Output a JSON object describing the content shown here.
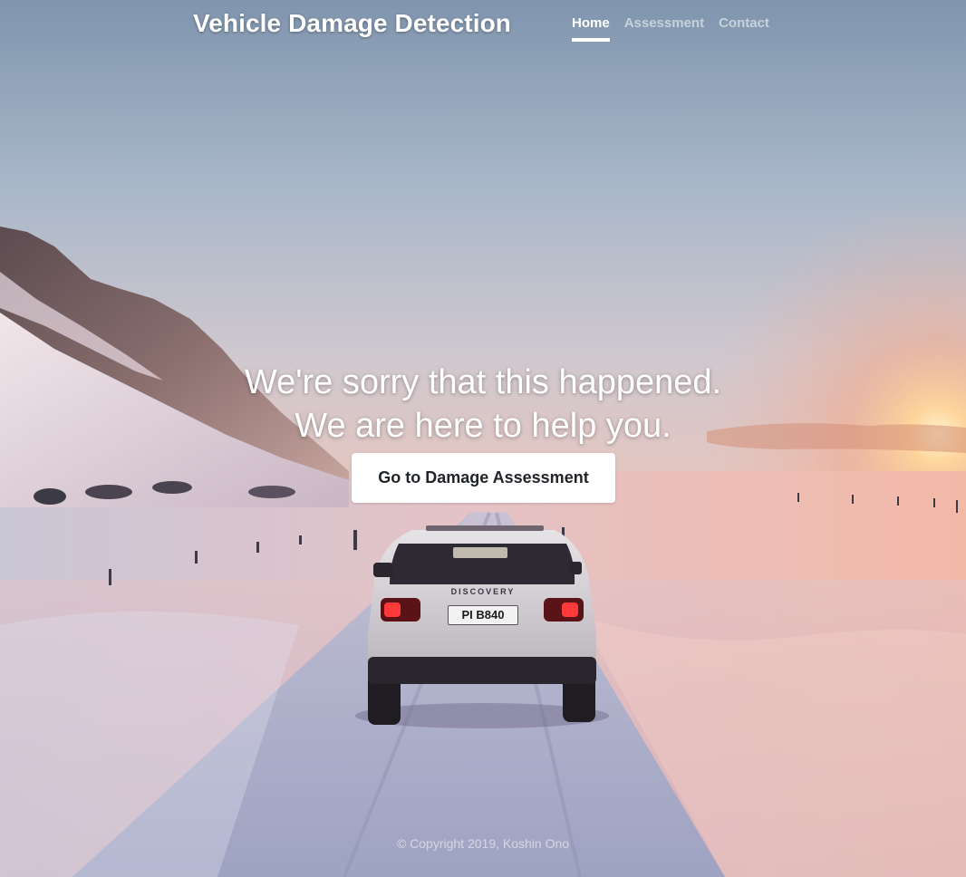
{
  "header": {
    "brand": "Vehicle Damage Detection",
    "nav": [
      {
        "label": "Home",
        "active": true
      },
      {
        "label": "Assessment",
        "active": false
      },
      {
        "label": "Contact",
        "active": false
      }
    ]
  },
  "hero": {
    "line1": "We're sorry that this happened.",
    "line2": "We are here to help you.",
    "cta_label": "Go to Damage Assessment"
  },
  "vehicle": {
    "badge": "DISCOVERY",
    "plate": "PI B840"
  },
  "footer": {
    "copyright": "© Copyright 2019, Koshin Ono"
  },
  "colors": {
    "accent": "#ffffff",
    "button_text": "#212529",
    "sky_top": "#8ea2ba",
    "sky_horizon": "#e4c8c4",
    "sun": "#fff3c0",
    "snow_light": "#e8d2d8",
    "snow_warm": "#f0b8a8"
  }
}
